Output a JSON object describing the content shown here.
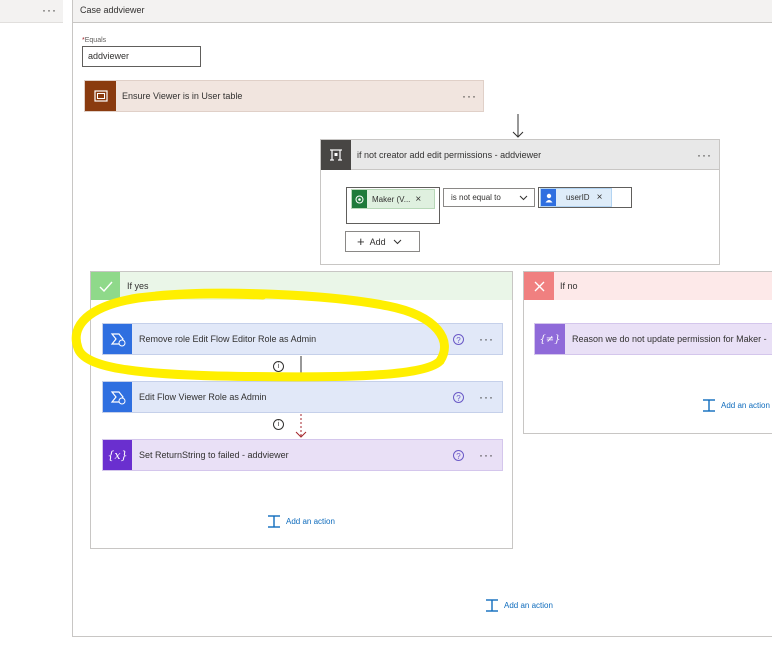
{
  "left_panel": {
    "menu_label": "···"
  },
  "case": {
    "title": "Case addviewer",
    "equals_label": "Equals",
    "equals_required": "*",
    "equals_value": "addviewer"
  },
  "ensure_step": {
    "title": "Ensure Viewer is in User table",
    "menu": "···",
    "icon": "scope-icon"
  },
  "condition": {
    "title": "if not creator add edit permissions - addviewer",
    "menu": "···",
    "left_token": "Maker (V...",
    "remove": "×",
    "operator": "is not equal to",
    "right_token": "userID",
    "add_button": "Add"
  },
  "if_yes": {
    "title": "If yes",
    "steps": [
      {
        "title": "Remove role Edit Flow Editor Role as Admin",
        "help": "?",
        "menu": "···"
      },
      {
        "title": "Edit Flow Viewer Role as Admin",
        "help": "?",
        "menu": "···"
      },
      {
        "title": "Set ReturnString to failed - addviewer",
        "help": "?",
        "menu": "···"
      }
    ],
    "info": "i",
    "add_action": "Add an action"
  },
  "if_no": {
    "title": "If no",
    "step_title": "Reason we do not update permission for Maker -",
    "add_action": "Add an action"
  },
  "bottom_add_action": "Add an action",
  "colors": {
    "scope_brown": "#8a3b0f",
    "scope_bg": "#f1e5df",
    "condition_gray": "#484644",
    "yes_green": "#8fd98a",
    "yes_bg": "#eaf6e8",
    "no_red": "#f08080",
    "no_bg": "#fde9e9",
    "flow_blue": "#2f6fe0",
    "step_bg": "#e1e8f8",
    "var_purple": "#6a2fcf",
    "var_bg": "#e9e0f6",
    "highlight": "#ffef00"
  }
}
